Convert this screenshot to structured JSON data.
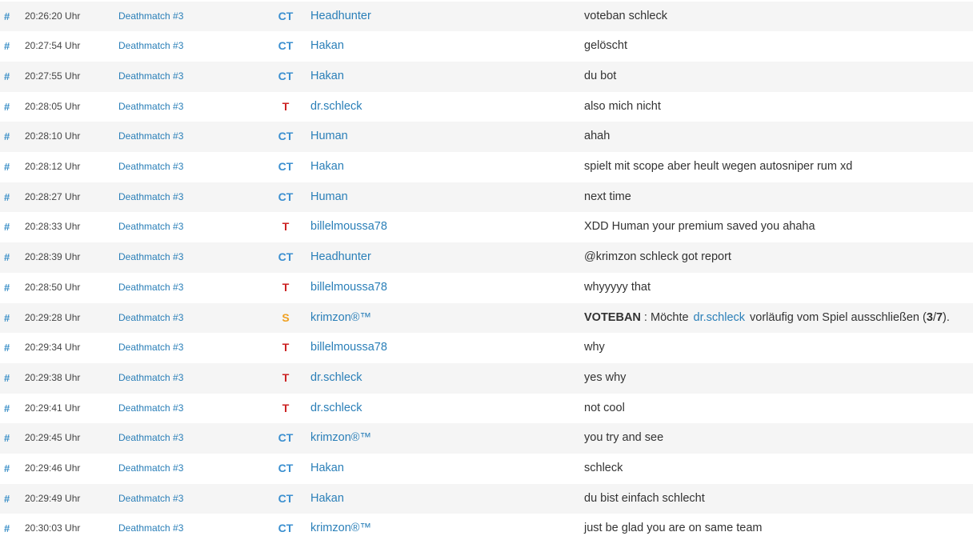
{
  "rows": [
    {
      "hash": "#",
      "time": "20:26:20 Uhr",
      "server": "Deathmatch #3",
      "team": "CT",
      "player": "Headhunter",
      "message": "voteban schleck"
    },
    {
      "hash": "#",
      "time": "20:27:54 Uhr",
      "server": "Deathmatch #3",
      "team": "CT",
      "player": "Hakan",
      "message": "gelöscht"
    },
    {
      "hash": "#",
      "time": "20:27:55 Uhr",
      "server": "Deathmatch #3",
      "team": "CT",
      "player": "Hakan",
      "message": "du bot"
    },
    {
      "hash": "#",
      "time": "20:28:05 Uhr",
      "server": "Deathmatch #3",
      "team": "T",
      "player": "dr.schleck",
      "message": "also mich nicht"
    },
    {
      "hash": "#",
      "time": "20:28:10 Uhr",
      "server": "Deathmatch #3",
      "team": "CT",
      "player": "Human",
      "message": "ahah"
    },
    {
      "hash": "#",
      "time": "20:28:12 Uhr",
      "server": "Deathmatch #3",
      "team": "CT",
      "player": "Hakan",
      "message": "spielt mit scope aber heult wegen autosniper rum xd"
    },
    {
      "hash": "#",
      "time": "20:28:27 Uhr",
      "server": "Deathmatch #3",
      "team": "CT",
      "player": "Human",
      "message": "next time"
    },
    {
      "hash": "#",
      "time": "20:28:33 Uhr",
      "server": "Deathmatch #3",
      "team": "T",
      "player": "billelmoussa78",
      "message": "XDD Human your premium saved you ahaha"
    },
    {
      "hash": "#",
      "time": "20:28:39 Uhr",
      "server": "Deathmatch #3",
      "team": "CT",
      "player": "Headhunter",
      "message": "@krimzon schleck got report"
    },
    {
      "hash": "#",
      "time": "20:28:50 Uhr",
      "server": "Deathmatch #3",
      "team": "T",
      "player": "billelmoussa78",
      "message": "whyyyyy that"
    },
    {
      "hash": "#",
      "time": "20:29:28 Uhr",
      "server": "Deathmatch #3",
      "team": "S",
      "player": "krimzon®™",
      "message": "",
      "vote": {
        "label": "VOTEBAN",
        "pre": " : Möchte",
        "target": "dr.schleck",
        "post": "vorläufig vom Spiel ausschließen (",
        "count": "3",
        "sep": "/",
        "total": "7",
        "end": ")."
      }
    },
    {
      "hash": "#",
      "time": "20:29:34 Uhr",
      "server": "Deathmatch #3",
      "team": "T",
      "player": "billelmoussa78",
      "message": "why"
    },
    {
      "hash": "#",
      "time": "20:29:38 Uhr",
      "server": "Deathmatch #3",
      "team": "T",
      "player": "dr.schleck",
      "message": "yes why"
    },
    {
      "hash": "#",
      "time": "20:29:41 Uhr",
      "server": "Deathmatch #3",
      "team": "T",
      "player": "dr.schleck",
      "message": "not cool"
    },
    {
      "hash": "#",
      "time": "20:29:45 Uhr",
      "server": "Deathmatch #3",
      "team": "CT",
      "player": "krimzon®™",
      "message": "you try and see"
    },
    {
      "hash": "#",
      "time": "20:29:46 Uhr",
      "server": "Deathmatch #3",
      "team": "CT",
      "player": "Hakan",
      "message": "schleck"
    },
    {
      "hash": "#",
      "time": "20:29:49 Uhr",
      "server": "Deathmatch #3",
      "team": "CT",
      "player": "Hakan",
      "message": "du bist einfach schlecht"
    },
    {
      "hash": "#",
      "time": "20:30:03 Uhr",
      "server": "Deathmatch #3",
      "team": "CT",
      "player": "krimzon®™",
      "message": "just be glad you are on same team"
    }
  ],
  "colors": {
    "link": "#2a7fb8",
    "team_ct": "#3a8fd0",
    "team_t": "#cc2222",
    "team_s": "#f0a020",
    "row_alt": "#f5f5f5"
  }
}
